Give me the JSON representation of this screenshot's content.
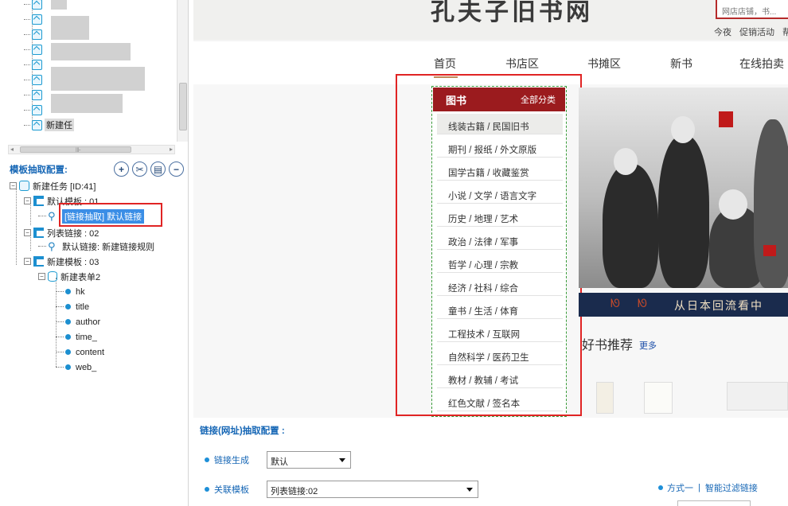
{
  "upper_tree": {
    "last_label": "新建任"
  },
  "scroll": {
    "h_arrow_left": "◂",
    "h_arrow_right": "▸",
    "mid": "⊪"
  },
  "template_config": {
    "title": "模板抽取配置:",
    "buttons": [
      "+",
      "✂",
      "▤",
      "−"
    ]
  },
  "tree": {
    "root": "新建任务 [ID:41]",
    "node1": "默认模板 : 01",
    "node1_child": "[链接抽取] 默认链接",
    "node2": "列表链接 : 02",
    "node2_child": "默认链接: 新建链接规则",
    "node3": "新建模板 : 03",
    "node3_child": "新建表单2",
    "fields": [
      "hk",
      "title",
      "author",
      "time_",
      "content",
      "web_"
    ]
  },
  "web": {
    "site_title": "孔夫子旧书网",
    "search_placeholder": "网店店铺，书...",
    "top_links": [
      "今夜",
      "促销活动",
      "帮助"
    ],
    "nav": [
      "首页",
      "书店区",
      "书摊区",
      "新书",
      "在线拍卖"
    ],
    "category": {
      "title": "图书",
      "more": "全部分类",
      "items": [
        "线装古籍 / 民国旧书",
        "期刊 / 报纸 / 外文原版",
        "国学古籍 / 收藏鉴赏",
        "小说 / 文学 / 语言文字",
        "历史 / 地理 / 艺术",
        "政治 / 法律 / 军事",
        "哲学 / 心理 / 宗教",
        "经济 / 社科 / 综合",
        "童书 / 生活 / 体育",
        "工程技术 / 互联网",
        "自然科学 / 医药卫生",
        "教材 / 教辅 / 考试",
        "红色文献 / 签名本"
      ]
    },
    "banner_text": "从日本回流看中",
    "good_books": "好书推荐",
    "more": "更多"
  },
  "link_config": {
    "title": "链接(网址)抽取配置 :",
    "row1_label": "链接生成",
    "row1_value": "默认",
    "row2_label": "关联模板",
    "row2_value": "列表链接:02",
    "right_link1": "方式一",
    "right_link2": "智能过滤链接"
  }
}
